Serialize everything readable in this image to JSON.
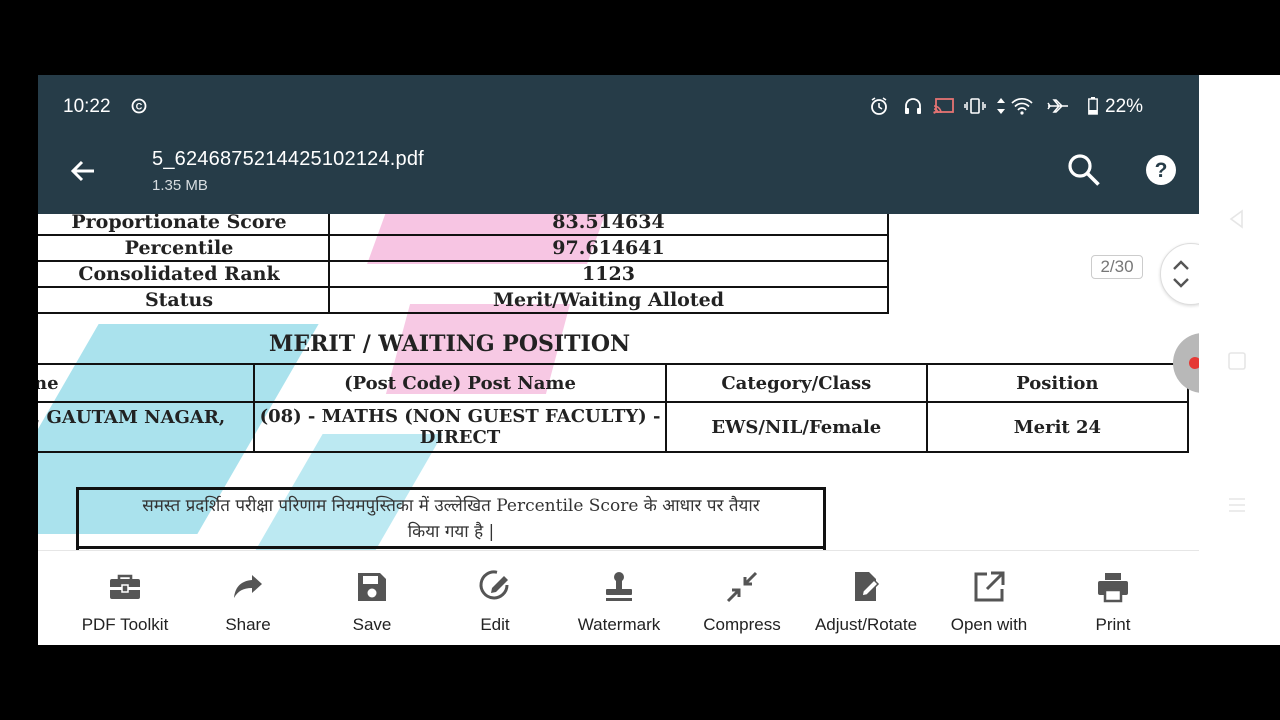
{
  "status": {
    "time": "10:22",
    "battery": "22%",
    "icons": [
      "cast-c-icon",
      "alarm-icon",
      "headset-icon",
      "screen-cast-icon",
      "vibrate-icon",
      "data-arrows-icon",
      "wifi-icon",
      "airplane-icon",
      "battery-icon"
    ]
  },
  "appbar": {
    "filename": "5_6246875214425102124.pdf",
    "filesize": "1.35 MB",
    "icons": [
      "back-arrow-icon",
      "search-icon",
      "help-icon"
    ]
  },
  "document": {
    "summary": [
      {
        "label": "Proportionate Score",
        "value": "83.514634"
      },
      {
        "label": "Percentile",
        "value": "97.614641"
      },
      {
        "label": "Consolidated Rank",
        "value": "1123"
      },
      {
        "label": "Status",
        "value": "Merit/Waiting Alloted"
      }
    ],
    "section_heading": "MERIT / WAITING POSITION",
    "table": {
      "headers": [
        "ne",
        "(Post Code) Post  Name",
        "Category/Class",
        "Position"
      ],
      "rows": [
        [
          ", GAUTAM NAGAR,",
          "(08) - MATHS (NON GUEST FACULTY) - DIRECT",
          "EWS/NIL/Female",
          "Merit 24"
        ]
      ]
    },
    "note_line1": "समस्त प्रदर्शित परीक्षा परिणाम नियमपुस्तिका में उल्लेखित Percentile Score के आधार पर तैयार",
    "note_line2": "किया गया है |"
  },
  "page_indicator": "2/30",
  "toolbar": {
    "items": [
      {
        "label": "PDF Toolkit",
        "icon": "toolbox-icon"
      },
      {
        "label": "Share",
        "icon": "share-arrow-icon"
      },
      {
        "label": "Save",
        "icon": "floppy-disk-icon"
      },
      {
        "label": "Edit",
        "icon": "pencil-circle-icon"
      },
      {
        "label": "Watermark",
        "icon": "stamp-icon"
      },
      {
        "label": "Compress",
        "icon": "compress-arrows-icon"
      },
      {
        "label": "Adjust/Rotate",
        "icon": "page-edit-icon"
      },
      {
        "label": "Open with",
        "icon": "open-external-icon"
      },
      {
        "label": "Print",
        "icon": "printer-icon"
      }
    ]
  },
  "colors": {
    "appbar_bg": "#263c48",
    "watermark_pink": "#f5b6dc",
    "watermark_cyan": "#86d6e6",
    "record_dot": "#e53935"
  }
}
